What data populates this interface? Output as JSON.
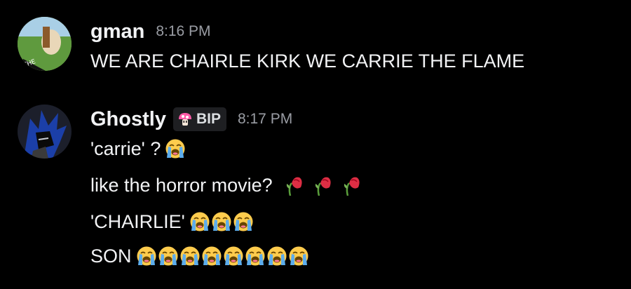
{
  "messages": [
    {
      "author": "gman",
      "time": "8:16 PM",
      "lines": [
        "WE ARE CHAIRLE KIRK WE CARRIE THE FLAME"
      ]
    },
    {
      "author": "Ghostly",
      "tag": "BIP",
      "time": "8:17 PM",
      "lines": [
        "'carrie' ?",
        "like the horror movie?",
        "'CHAIRLIE'",
        "SON"
      ],
      "emoji_counts": {
        "line1_loudly_crying": 1,
        "line2_wilted_rose": 3,
        "line3_loudly_crying": 3,
        "line4_loudly_crying": 8
      },
      "emoji_names": [
        "loudly-crying-face",
        "wilted-flower"
      ]
    }
  ],
  "colors": {
    "background": "#000000",
    "text": "#f2f3f5",
    "timestamp": "#9a9da4",
    "tag_bg": "#1e1f22"
  }
}
